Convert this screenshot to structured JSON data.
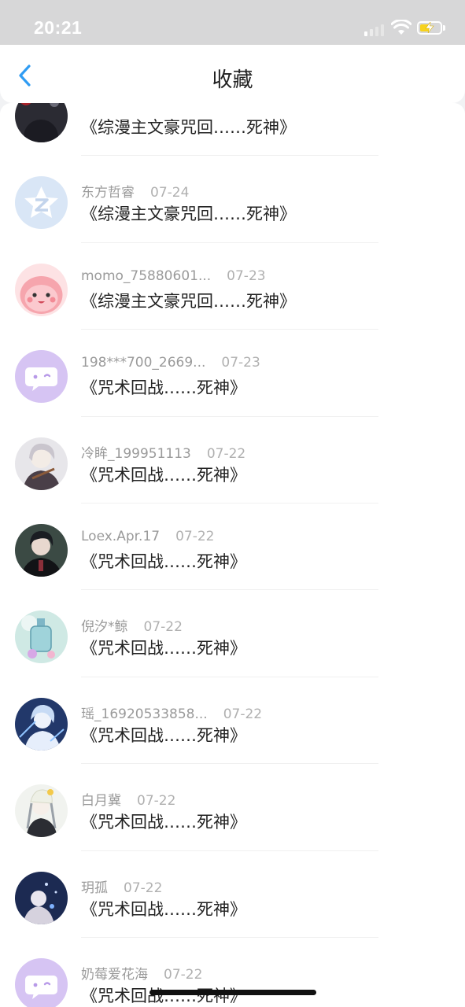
{
  "status_bar": {
    "time": "20:21",
    "battery_level": 0.55,
    "battery_color": "#f7d21c",
    "charging": true
  },
  "nav": {
    "title": "收藏",
    "back_icon": "chevron-left-icon",
    "accent": "#2f9cf3"
  },
  "favorites": [
    {
      "user": "",
      "date": "",
      "title": "《综漫主文豪咒回……死神》",
      "avatar": "dark-art"
    },
    {
      "user": "东方哲睿",
      "date": "07-24",
      "title": "《综漫主文豪咒回……死神》",
      "avatar": "default-q"
    },
    {
      "user": "momo_75880601...",
      "date": "07-23",
      "title": "《综漫主文豪咒回……死神》",
      "avatar": "pink-mascot"
    },
    {
      "user": "198***700_2669...",
      "date": "07-23",
      "title": "《咒术回战……死神》",
      "avatar": "default-chat"
    },
    {
      "user": "冷眸_199951113",
      "date": "07-22",
      "title": "《咒术回战……死神》",
      "avatar": "anime-light"
    },
    {
      "user": "Loex.Apr.17",
      "date": "07-22",
      "title": "《咒术回战……死神》",
      "avatar": "anime-dark"
    },
    {
      "user": "倪汐*鲸",
      "date": "07-22",
      "title": "《咒术回战……死神》",
      "avatar": "bottle"
    },
    {
      "user": "瑶_16920533858...",
      "date": "07-22",
      "title": "《咒术回战……死神》",
      "avatar": "anime-blue"
    },
    {
      "user": "白月冀",
      "date": "07-22",
      "title": "《咒术回战……死神》",
      "avatar": "anime-white"
    },
    {
      "user": "玥孤",
      "date": "07-22",
      "title": "《咒术回战……死神》",
      "avatar": "night"
    },
    {
      "user": "奶莓爱花海",
      "date": "07-22",
      "title": "《咒术回战……死神》",
      "avatar": "default-chat"
    }
  ]
}
